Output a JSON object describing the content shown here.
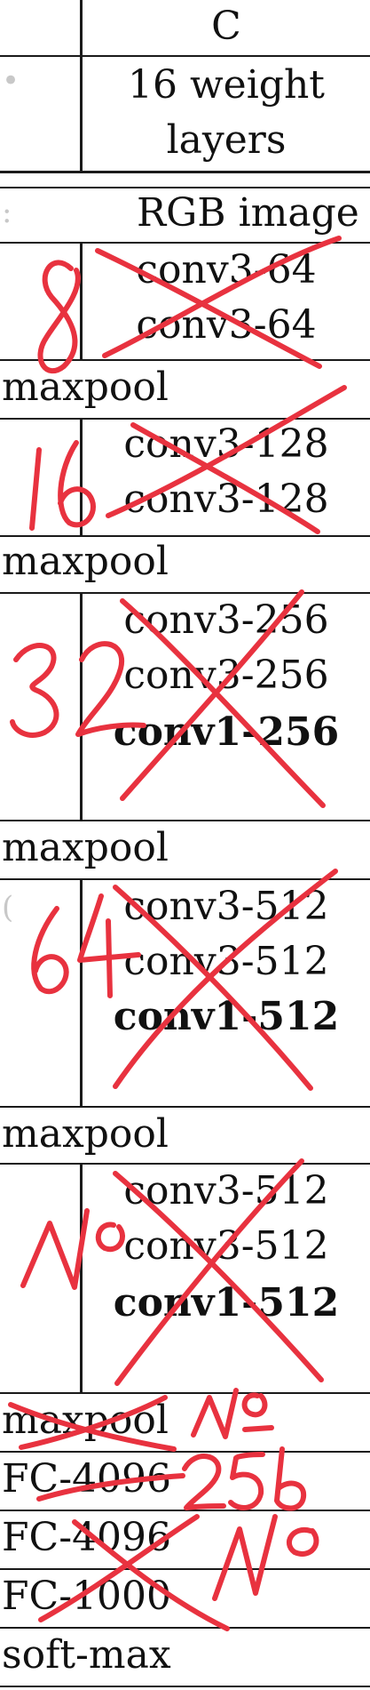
{
  "header": {
    "column_letter": "C",
    "weight_layers_line1": "16 weight",
    "weight_layers_line2": "layers"
  },
  "input_row": {
    "label": "RGB image"
  },
  "blocks": [
    {
      "layers": [
        "conv3-64",
        "conv3-64"
      ]
    },
    {
      "layers": [
        "conv3-128",
        "conv3-128"
      ]
    },
    {
      "layers": [
        "conv3-256",
        "conv3-256",
        "conv1-256"
      ]
    },
    {
      "layers": [
        "conv3-512",
        "conv3-512",
        "conv1-512"
      ]
    },
    {
      "layers": [
        "conv3-512",
        "conv3-512",
        "conv1-512"
      ]
    }
  ],
  "maxpool_label": "maxpool",
  "fc_rows": [
    "FC-4096",
    "FC-4096",
    "FC-1000"
  ],
  "softmax_label": "soft-max",
  "handwritten": {
    "note_block1": "8",
    "note_block2": "16",
    "note_block3": "32",
    "note_block4": "64",
    "note_block5": "No",
    "note_maxpool_last": "No",
    "note_fc1": "256",
    "note_fc2": "No"
  },
  "colors": {
    "ink": "#111111",
    "rule": "#1a1a1a",
    "annotation": "#e8323f"
  }
}
